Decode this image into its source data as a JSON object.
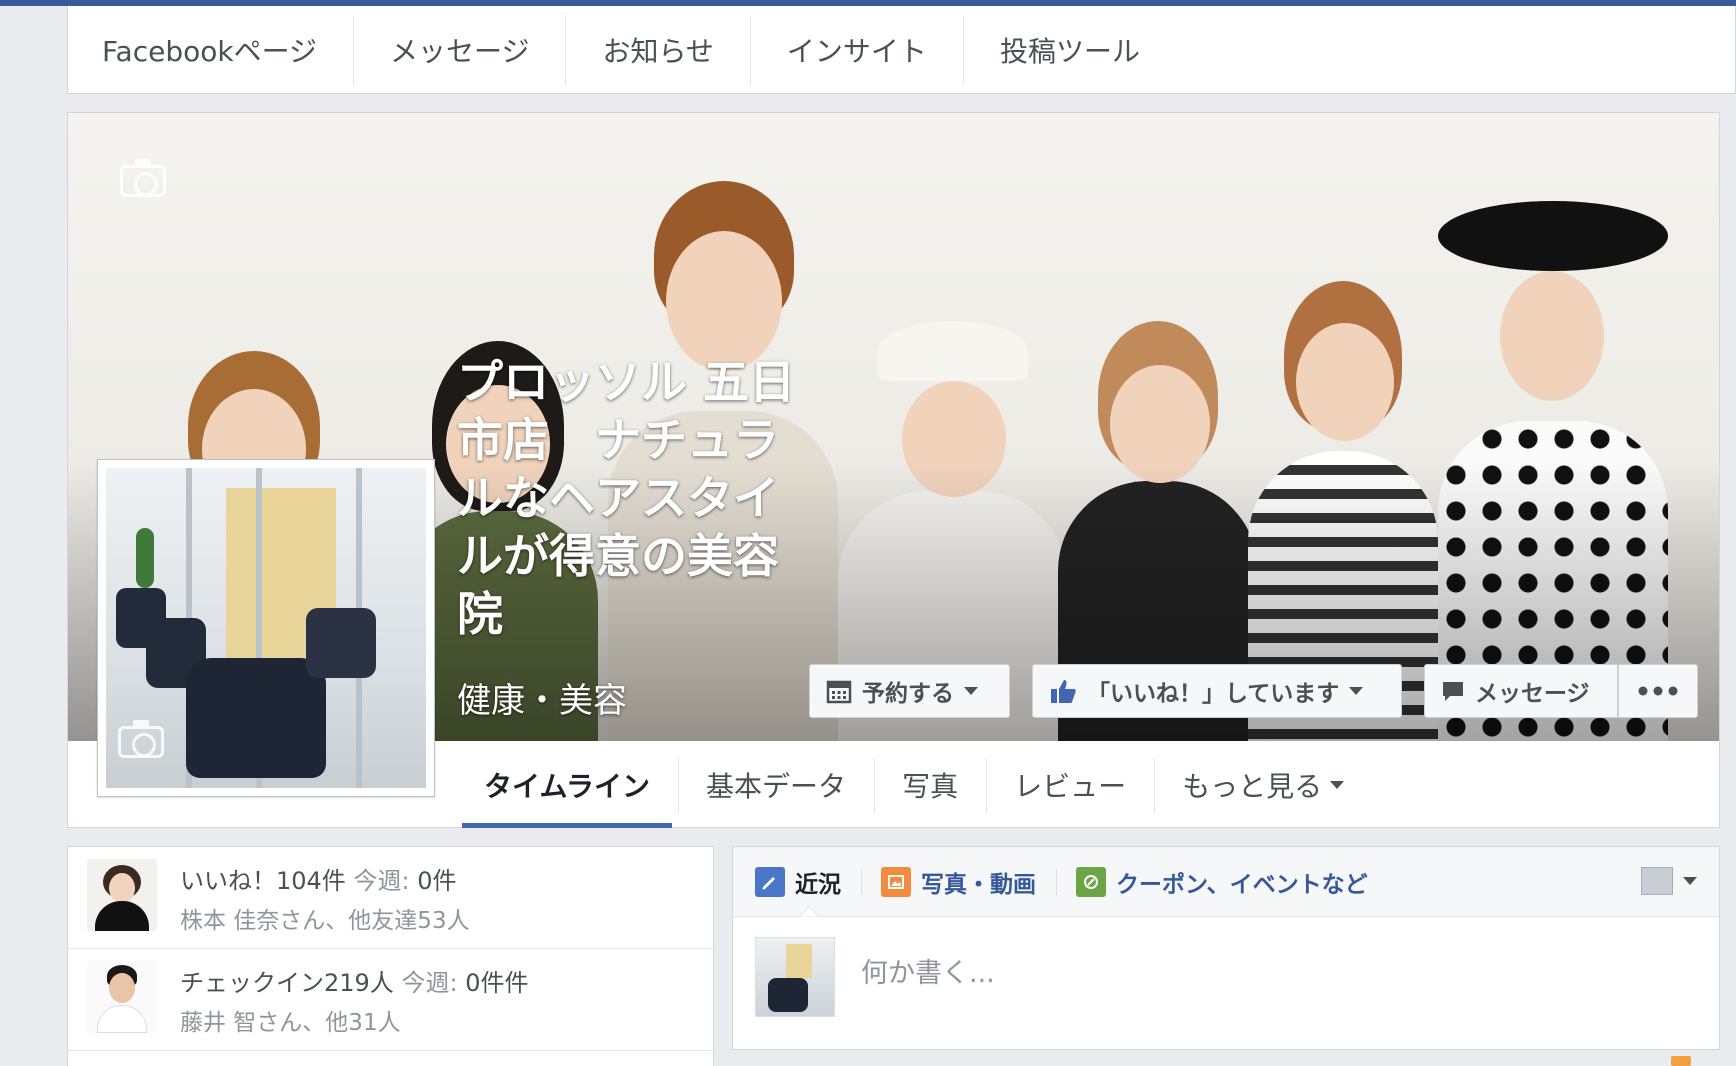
{
  "admin_nav": {
    "items": [
      "Facebookページ",
      "メッセージ",
      "お知らせ",
      "インサイト",
      "投稿ツール"
    ]
  },
  "page": {
    "title": "プロッソル 五日市店　ナチュラルなヘアスタイルが得意の美容院",
    "category": "健康・美容"
  },
  "cover_buttons": {
    "book": "予約する",
    "liked": "「いいね！」しています",
    "message": "メッセージ"
  },
  "tabs": {
    "timeline": "タイムライン",
    "about": "基本データ",
    "photos": "写真",
    "reviews": "レビュー",
    "more": "もっと見る"
  },
  "stats": {
    "likes": {
      "main": "いいね！104件",
      "week_label": "今週",
      "week_value": "0件",
      "friends": "株本 佳奈さん、他友達53人"
    },
    "checkins": {
      "main": "チェックイン219人",
      "week_label": "今週",
      "week_value": "0件件",
      "friends": "藤井 智さん、他31人"
    }
  },
  "composer": {
    "status": "近況",
    "photo": "写真・動画",
    "offer": "クーポン、イベントなど",
    "placeholder": "何か書く..."
  },
  "colors": {
    "brand": "#3b5998",
    "link": "#365899",
    "tab_underline": "#4267b2",
    "like_blue": "#4267b2",
    "status_icon": "#4a76c7",
    "photo_icon": "#f08c3c",
    "offer_icon": "#6ba546"
  }
}
